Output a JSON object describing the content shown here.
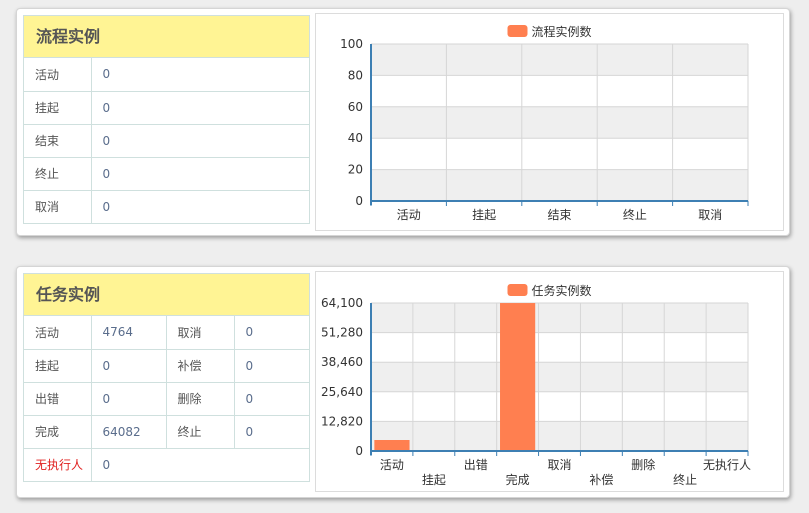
{
  "process": {
    "title": "流程实例",
    "rows": [
      {
        "label": "活动",
        "value": "0"
      },
      {
        "label": "挂起",
        "value": "0"
      },
      {
        "label": "结束",
        "value": "0"
      },
      {
        "label": "终止",
        "value": "0"
      },
      {
        "label": "取消",
        "value": "0"
      }
    ]
  },
  "task": {
    "title": "任务实例",
    "rows": [
      {
        "l1": "活动",
        "v1": "4764",
        "l2": "取消",
        "v2": "0"
      },
      {
        "l1": "挂起",
        "v1": "0",
        "l2": "补偿",
        "v2": "0"
      },
      {
        "l1": "出错",
        "v1": "0",
        "l2": "删除",
        "v2": "0"
      },
      {
        "l1": "完成",
        "v1": "64082",
        "l2": "终止",
        "v2": "0"
      },
      {
        "l1": "无执行人",
        "v1": "0"
      }
    ]
  },
  "colors": {
    "bar": "#ff7f50",
    "warn": "#e0201f",
    "title_bg": "#fff494",
    "axis": "#3d7fb3"
  },
  "chart_data": [
    {
      "type": "bar",
      "series": [
        {
          "name": "流程实例数",
          "values": [
            0,
            0,
            0,
            0,
            0
          ]
        }
      ],
      "categories": [
        "活动",
        "挂起",
        "结束",
        "终止",
        "取消"
      ],
      "yticks": [
        "0",
        "20",
        "40",
        "60",
        "80",
        "100"
      ],
      "ylim": [
        0,
        100
      ],
      "grid": true,
      "legend": "top-center"
    },
    {
      "type": "bar",
      "series": [
        {
          "name": "任务实例数",
          "values": [
            4764,
            0,
            0,
            64082,
            0,
            0,
            0,
            0,
            0
          ]
        }
      ],
      "categories": [
        "活动",
        "挂起",
        "出错",
        "完成",
        "取消",
        "补偿",
        "删除",
        "终止",
        "无执行人"
      ],
      "yticks": [
        "0",
        "12,820",
        "25,640",
        "38,460",
        "51,280",
        "64,100"
      ],
      "ylim": [
        0,
        64100
      ],
      "grid": true,
      "legend": "top-center"
    }
  ]
}
